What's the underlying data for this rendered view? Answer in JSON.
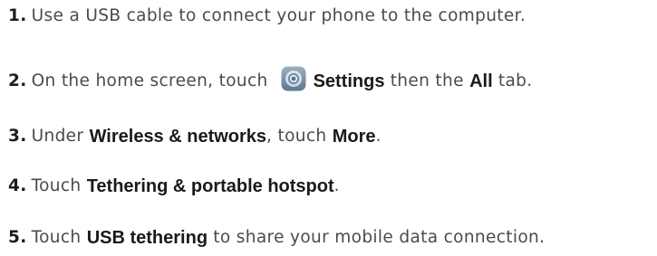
{
  "steps": [
    {
      "num": "1.",
      "text": "Use a USB cable to connect your phone to the computer."
    },
    {
      "num": "2.",
      "pre": "On the home screen, touch",
      "icon": "settings-icon",
      "bold1": "Settings",
      "mid": "then the",
      "bold2": "All",
      "post": "tab."
    },
    {
      "num": "3.",
      "pre": "Under",
      "bold1": "Wireless & networks",
      "mid": ", touch",
      "bold2": "More",
      "post": "."
    },
    {
      "num": "4.",
      "pre": "Touch",
      "bold1": "Tethering & portable hotspot",
      "post": "."
    },
    {
      "num": "5.",
      "pre": "Touch",
      "bold1": "USB tethering",
      "post": "to share your mobile data connection."
    }
  ]
}
